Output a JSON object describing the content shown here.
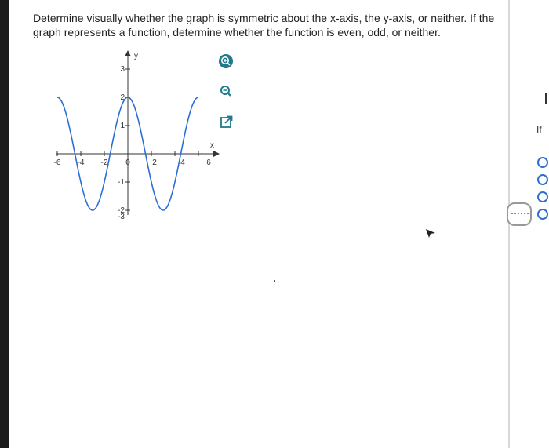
{
  "question": {
    "text": "Determine visually whether the graph is symmetric about the x-axis, the y-axis, or neither. If the graph represents a function, determine whether the function is even, odd, or neither."
  },
  "graph": {
    "x_axis_label": "x",
    "y_axis_label": "y",
    "x_tick_labels": [
      "-6",
      "-4",
      "-2",
      "0",
      "2",
      "4",
      "6"
    ],
    "y_tick_labels": [
      "3",
      "2",
      "1",
      "-1",
      "-2",
      "-3"
    ]
  },
  "tools": {
    "zoom_in_icon": "zoom-in-icon",
    "zoom_out_icon": "zoom-out-icon",
    "expand_icon": "external-link-icon"
  },
  "side_panel": {
    "partial_text": "If"
  },
  "colors": {
    "curve": "#2b6fd6",
    "tool_icon": "#1f7a8c",
    "radio": "#2b6fd6"
  }
}
